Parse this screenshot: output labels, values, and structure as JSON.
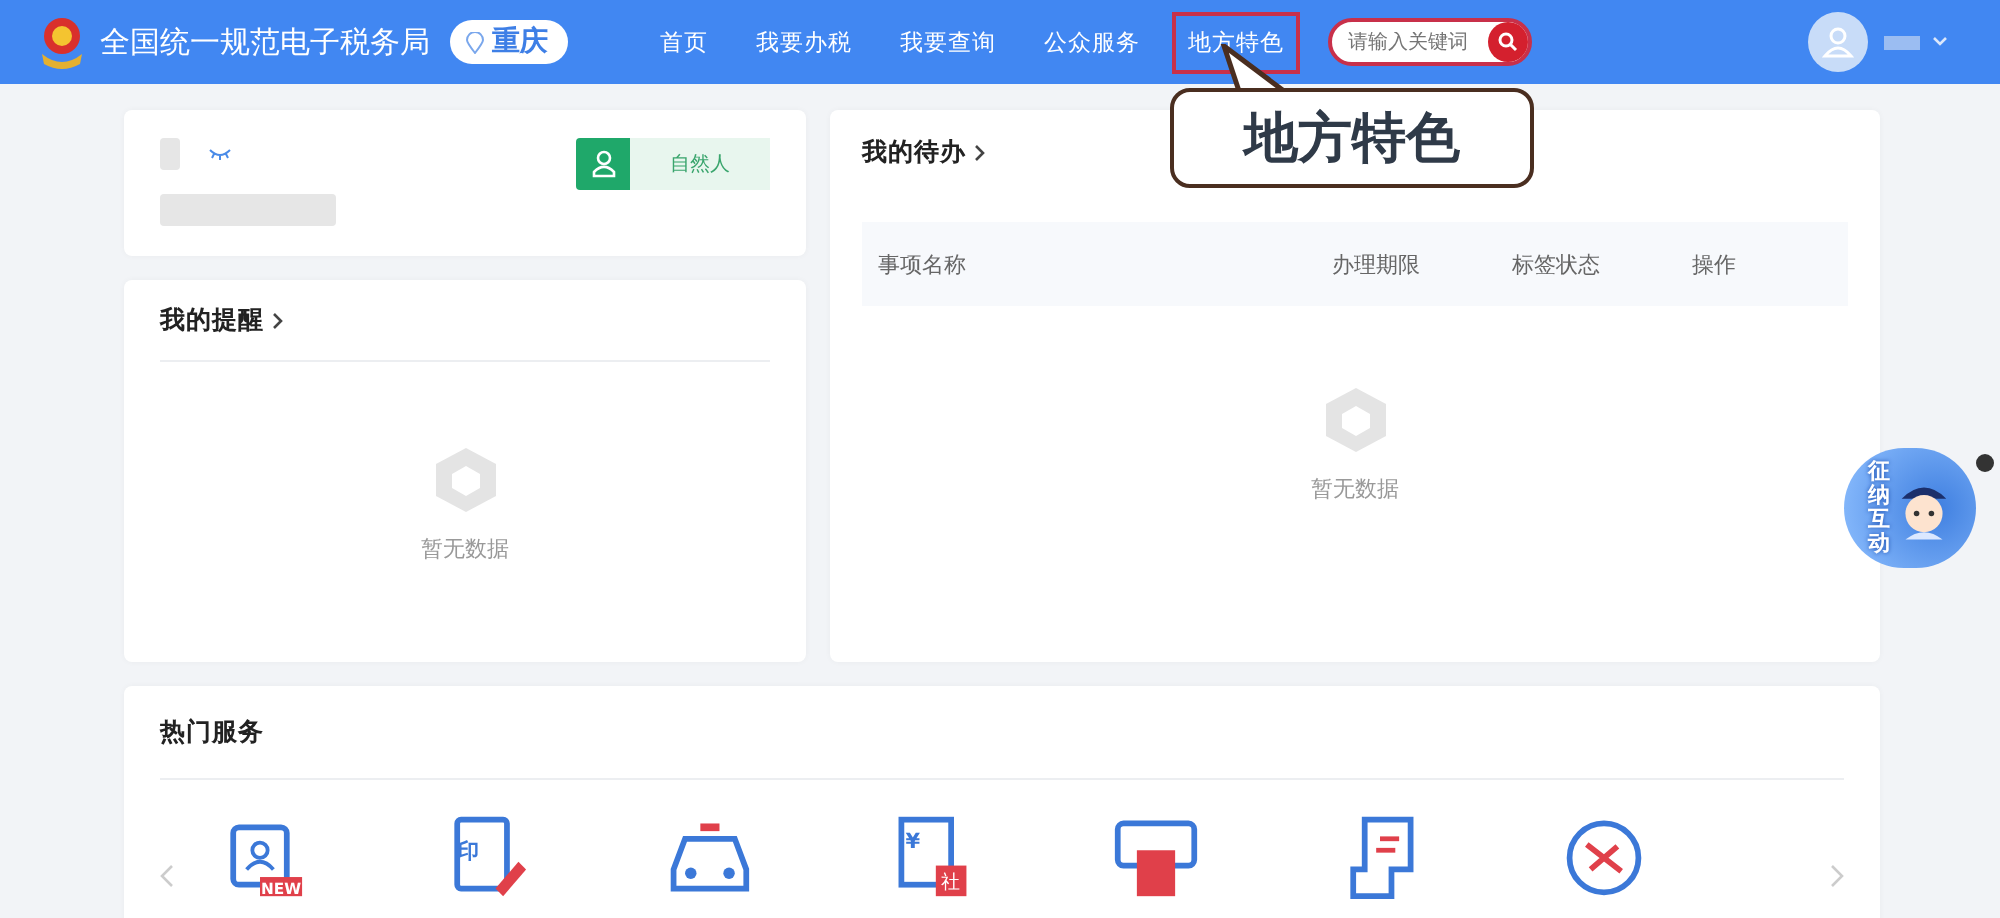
{
  "header": {
    "site_title": "全国统一规范电子税务局",
    "location": "重庆",
    "nav": [
      {
        "label": "首页",
        "selected": false
      },
      {
        "label": "我要办税",
        "selected": false
      },
      {
        "label": "我要查询",
        "selected": false
      },
      {
        "label": "公众服务",
        "selected": false
      },
      {
        "label": "地方特色",
        "selected": true
      }
    ],
    "search": {
      "placeholder": "请输入关键词"
    }
  },
  "callout": {
    "text": "地方特色"
  },
  "profile": {
    "role": "自然人"
  },
  "reminders": {
    "title": "我的提醒",
    "empty_text": "暂无数据"
  },
  "todo": {
    "title": "我的待办",
    "columns": [
      "事项名称",
      "办理期限",
      "标签状态",
      "操作"
    ],
    "empty_text": "暂无数据"
  },
  "hot_services": {
    "title": "热门服务",
    "items": [
      {
        "kind": "id-card",
        "badge": "NEW"
      },
      {
        "kind": "seal",
        "badge": "印"
      },
      {
        "kind": "car"
      },
      {
        "kind": "invoice",
        "badge": "¥",
        "badge2": "社"
      },
      {
        "kind": "printer"
      },
      {
        "kind": "scroll"
      },
      {
        "kind": "no-link"
      }
    ]
  },
  "float_widget": {
    "text": "征纳互动"
  }
}
